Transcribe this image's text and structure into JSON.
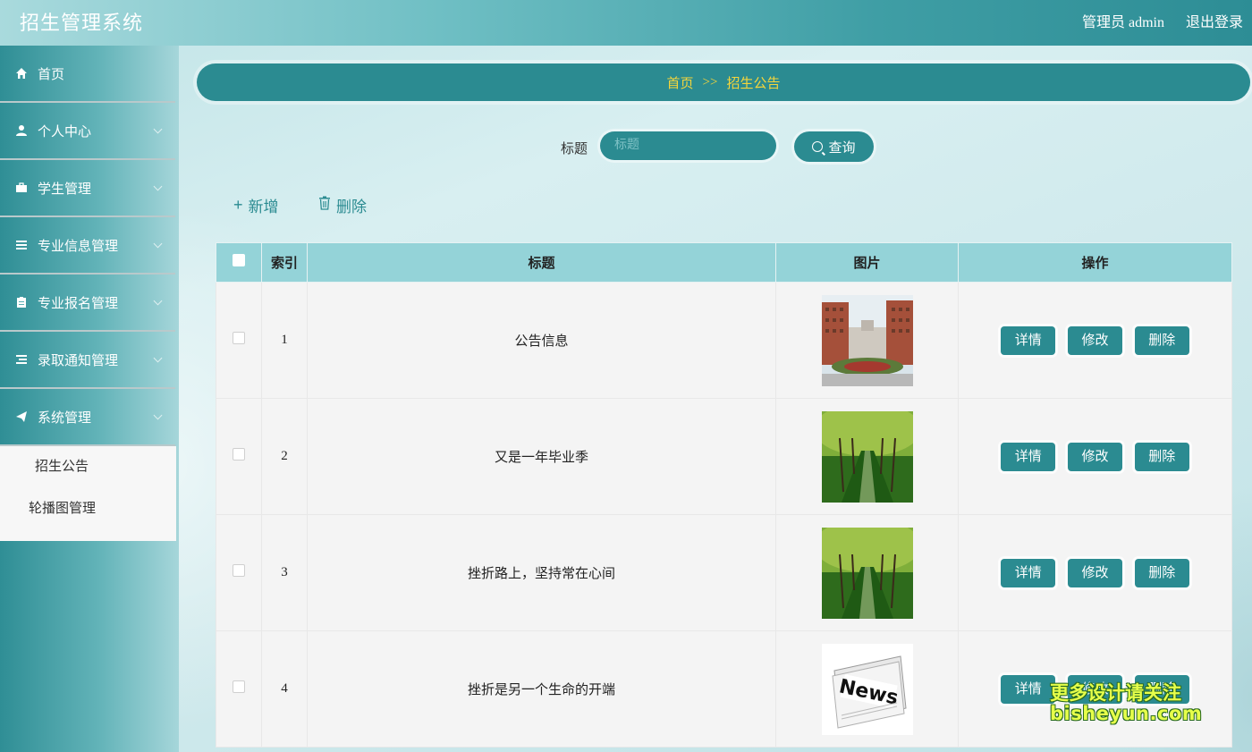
{
  "header": {
    "app_title": "招生管理系统",
    "user_label": "管理员 admin",
    "logout_label": "退出登录"
  },
  "sidebar": {
    "items": [
      {
        "label": "首页",
        "icon": "home-icon"
      },
      {
        "label": "个人中心",
        "icon": "user-icon"
      },
      {
        "label": "学生管理",
        "icon": "briefcase-icon"
      },
      {
        "label": "专业信息管理",
        "icon": "list-icon"
      },
      {
        "label": "专业报名管理",
        "icon": "clipboard-icon"
      },
      {
        "label": "录取通知管理",
        "icon": "list-indent-icon"
      },
      {
        "label": "系统管理",
        "icon": "send-icon"
      }
    ],
    "submenu": [
      {
        "label": "招生公告"
      },
      {
        "label": "轮播图管理"
      }
    ]
  },
  "breadcrumb": {
    "home": "首页",
    "separator": ">>",
    "current": "招生公告"
  },
  "search": {
    "label": "标题",
    "placeholder": "标题",
    "value": "",
    "button_label": "查询"
  },
  "actions": {
    "add_label": "新增",
    "delete_label": "删除"
  },
  "table": {
    "columns": [
      "索引",
      "标题",
      "图片",
      "操作"
    ],
    "rows": [
      {
        "index": "1",
        "title": "公告信息",
        "image": "campus-building"
      },
      {
        "index": "2",
        "title": "又是一年毕业季",
        "image": "tree-avenue"
      },
      {
        "index": "3",
        "title": "挫折路上，坚持常在心间",
        "image": "tree-avenue"
      },
      {
        "index": "4",
        "title": "挫折是另一个生命的开端",
        "image": "newspaper"
      }
    ],
    "op_labels": {
      "detail": "详情",
      "edit": "修改",
      "delete": "删除"
    }
  },
  "watermark": {
    "line1": "更多设计请关注",
    "line2": "bisheyun.com"
  },
  "colors": {
    "accent": "#2b8b91",
    "breadcrumb_text": "#f5d53b",
    "table_header": "#94d3d8"
  }
}
